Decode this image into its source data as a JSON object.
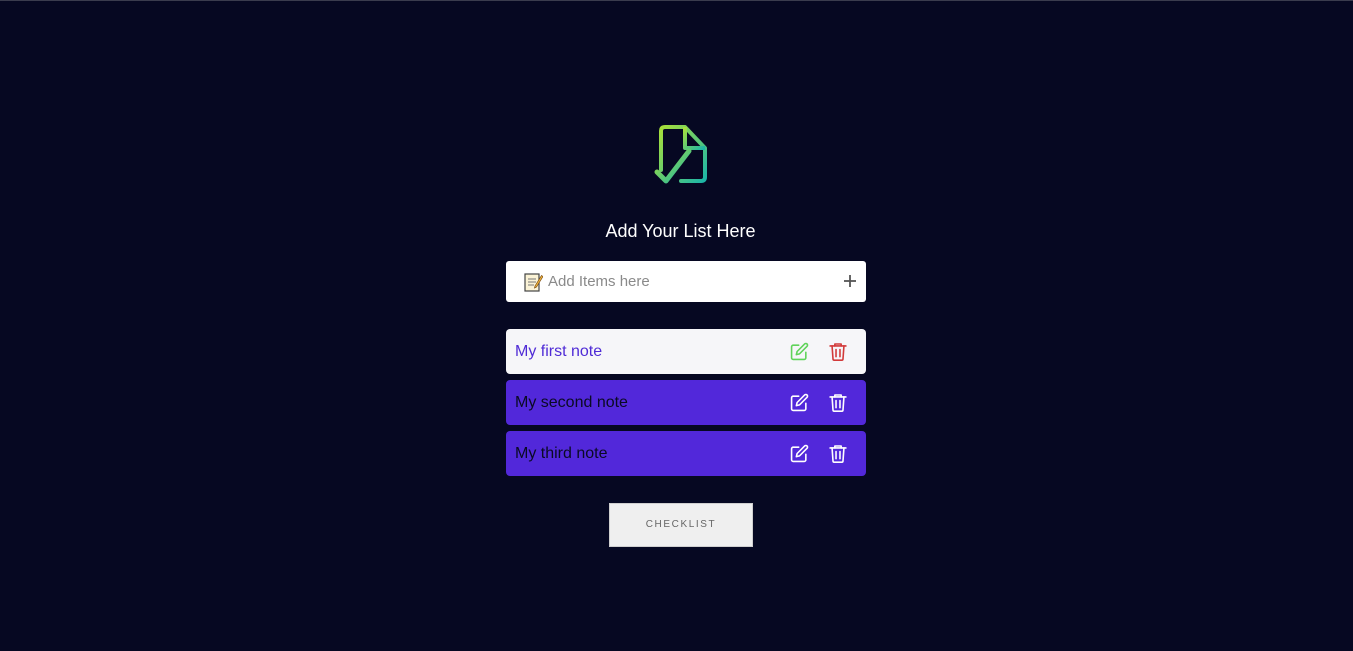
{
  "app": {
    "logo_icon": "document-check-icon",
    "heading": "Add Your List Here"
  },
  "input": {
    "icon": "memo-icon",
    "placeholder": "Add Items here",
    "value": "",
    "add_icon": "plus-icon"
  },
  "notes": [
    {
      "text": "My first note",
      "style": "light",
      "edit_icon": "edit-icon",
      "delete_icon": "trash-icon"
    },
    {
      "text": "My second note",
      "style": "purple",
      "edit_icon": "edit-icon",
      "delete_icon": "trash-icon"
    },
    {
      "text": "My third note",
      "style": "purple",
      "edit_icon": "edit-icon",
      "delete_icon": "trash-icon"
    }
  ],
  "checklist_button": "CHECKLIST",
  "colors": {
    "background": "#060822",
    "note_purple": "#5228da",
    "note_light": "#f6f6f9",
    "note_light_text": "#4f2bd6",
    "edit_green": "#5fd35a",
    "delete_red": "#d23a3a",
    "logo_gradient_start": "#a8e03a",
    "logo_gradient_end": "#1bb5a8"
  }
}
